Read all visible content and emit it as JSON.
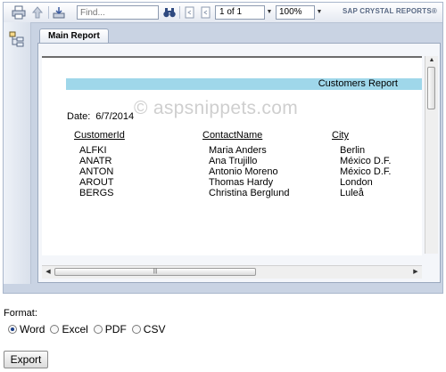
{
  "toolbar": {
    "find_placeholder": "Find...",
    "page_display": "1 of 1",
    "zoom": "100%",
    "brand": "SAP CRYSTAL REPORTS®"
  },
  "tabs": [
    {
      "label": "Main Report"
    }
  ],
  "report": {
    "title": "Customers Report",
    "watermark": "© aspsnippets.com",
    "date_label": "Date:",
    "date_value": "6/7/2014",
    "columns": [
      "CustomerId",
      "ContactName",
      "City"
    ],
    "rows": [
      [
        "ALFKI",
        "Maria Anders",
        "Berlin"
      ],
      [
        "ANATR",
        "Ana Trujillo",
        "México D.F."
      ],
      [
        "ANTON",
        "Antonio Moreno",
        "México D.F."
      ],
      [
        "AROUT",
        "Thomas Hardy",
        "London"
      ],
      [
        "BERGS",
        "Christina Berglund",
        "Luleå"
      ]
    ]
  },
  "export": {
    "format_label": "Format:",
    "options": [
      "Word",
      "Excel",
      "PDF",
      "CSV"
    ],
    "selected": "Word",
    "button_label": "Export"
  }
}
